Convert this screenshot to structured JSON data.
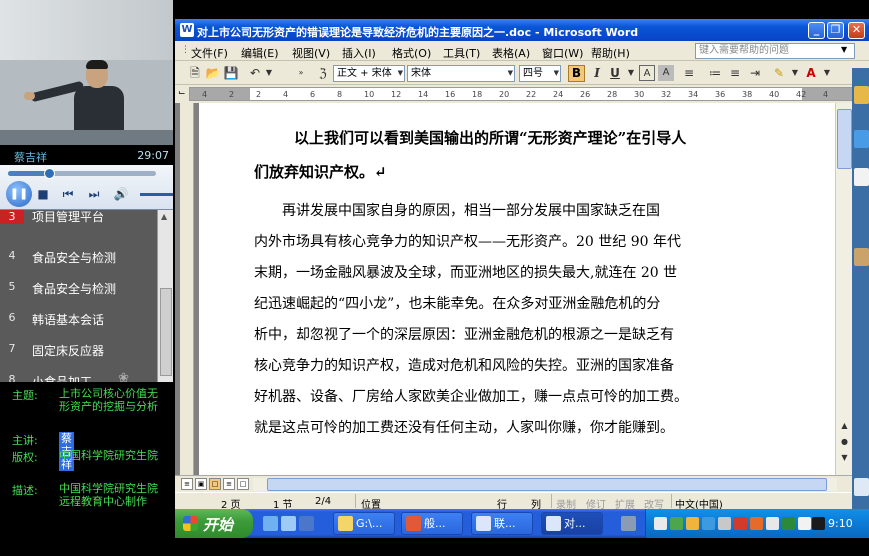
{
  "player": {
    "speaker": "蔡吉祥",
    "time": "29:07",
    "progress": 0.28,
    "playlist": [
      {
        "num": "3",
        "label": "项目管理平台",
        "active": true
      },
      {
        "num": "4",
        "label": "食品安全与检测",
        "active": false
      },
      {
        "num": "5",
        "label": "食品安全与检测",
        "active": false
      },
      {
        "num": "6",
        "label": "韩语基本会话",
        "active": false
      },
      {
        "num": "7",
        "label": "固定床反应器",
        "active": false
      },
      {
        "num": "8",
        "label": "小食品加工",
        "active": false
      }
    ],
    "info": {
      "topic_key": "主题:",
      "topic": "上市公司核心价值无形资产的挖掘与分析",
      "lecturer_key": "主讲:",
      "lecturer": "蔡吉祥",
      "copyright_key": "版权:",
      "copyright": "中国科学院研究生院",
      "desc_key": "描述:",
      "desc": "中国科学院研究生院远程教育中心制作"
    }
  },
  "word": {
    "title": "对上市公司无形资产的错误理论是导致经济危机的主要原因之一.doc - Microsoft Word",
    "menu": [
      "文件(F)",
      "编辑(E)",
      "视图(V)",
      "插入(I)",
      "格式(O)",
      "工具(T)",
      "表格(A)",
      "窗口(W)",
      "帮助(H)"
    ],
    "help_placeholder": "键入需要帮助的问题",
    "style_box": "正文 + 宋体",
    "font_box": "宋体",
    "size_box": "四号",
    "ruler_marks": [
      "4",
      "2",
      "2",
      "4",
      "6",
      "8",
      "10",
      "12",
      "14",
      "16",
      "18",
      "20",
      "22",
      "24",
      "26",
      "28",
      "30",
      "32",
      "34",
      "36",
      "38",
      "40",
      "42",
      "4"
    ],
    "doc_lines": [
      {
        "text": "以上我们可以看到美国输出的所谓“无形资产理论”在引导人",
        "bold": true
      },
      {
        "text": "们放弃知识产权。↵",
        "bold": true
      },
      {
        "text": "　　再讲发展中国家自身的原因，相当一部分发展中国家缺乏在国",
        "bold": false
      },
      {
        "text": "内外市场具有核心竞争力的知识产权——无形资产。20 世纪 90 年代",
        "bold": false
      },
      {
        "text": "末期，一场金融风暴波及全球，而亚洲地区的损失最大,就连在 20 世",
        "bold": false
      },
      {
        "text": "纪迅速崛起的“四小龙”，也未能幸免。在众多对亚洲金融危机的分",
        "bold": false
      },
      {
        "text": "析中，却忽视了一个的深层原因：亚洲金融危机的根源之一是缺乏有",
        "bold": false
      },
      {
        "text": "核心竞争力的知识产权，造成对危机和风险的失控。亚洲的国家准备",
        "bold": false
      },
      {
        "text": "好机器、设备、厂房给人家欧美企业做加工，赚一点点可怜的加工费。",
        "bold": false
      },
      {
        "text": "就是这点可怜的加工费还没有任何主动，人家叫你赚，你才能赚到。",
        "bold": false
      }
    ],
    "status": {
      "page": "2 页",
      "section": "1 节",
      "pages": "2/4",
      "position": "位置",
      "line": "行",
      "col": "列",
      "rec": "录制",
      "trk": "修订",
      "ext": "扩展",
      "ovr": "改写",
      "lang": "中文(中国)"
    }
  },
  "taskbar": {
    "start": "开始",
    "tasks": [
      "G:\\...",
      "般...",
      "联...",
      "对..."
    ],
    "clock": "9:10"
  },
  "colors": {
    "accent": "#0a56d8",
    "playlist_bg": "#5a5a5a",
    "info_text": "#44dd55",
    "active_num": "#c82222"
  }
}
